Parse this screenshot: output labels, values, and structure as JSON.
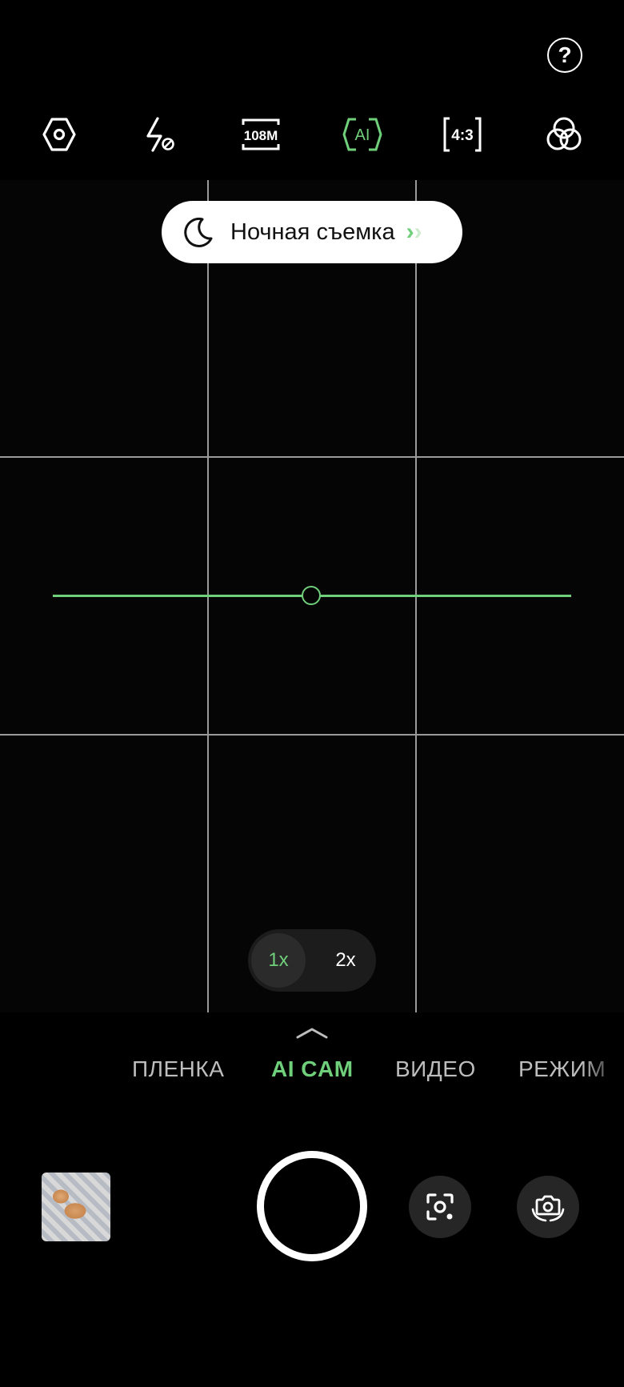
{
  "toolbar": {
    "icons": [
      "settings-icon",
      "flash-off-icon",
      "108mp-icon",
      "ai-icon",
      "aspect-ratio-icon",
      "filters-icon"
    ],
    "resolution_label": "108M",
    "ai_label": "AI",
    "aspect_ratio_label": "4:3"
  },
  "help": {
    "label": "?"
  },
  "scene": {
    "label": "Ночная съемка",
    "chevron": "›",
    "chevron2": "›"
  },
  "zoom": {
    "options": [
      "1x",
      "2x"
    ],
    "selected": "1x"
  },
  "modes": {
    "items": [
      "ПЛЕНКА",
      "AI CAM",
      "ВИДЕО",
      "РЕЖИМ"
    ],
    "selected": "AI CAM"
  },
  "colors": {
    "accent": "#6fcf7a",
    "background": "#000000",
    "grid": "#9a9a9a"
  }
}
